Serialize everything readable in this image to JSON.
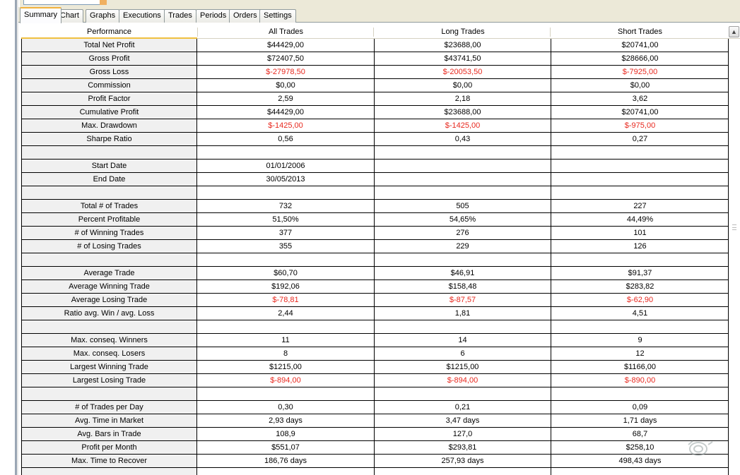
{
  "tabs": [
    "Summary",
    "Chart",
    "Graphs",
    "Executions",
    "Trades",
    "Periods",
    "Orders",
    "Settings"
  ],
  "active_tab": "Summary",
  "columns": [
    "Performance",
    "All Trades",
    "Long Trades",
    "Short Trades"
  ],
  "rows": [
    {
      "label": "Total Net Profit",
      "all": "$44429,00",
      "long": "$23688,00",
      "short": "$20741,00",
      "neg": [
        false,
        false,
        false
      ]
    },
    {
      "label": "Gross Profit",
      "all": "$72407,50",
      "long": "$43741,50",
      "short": "$28666,00",
      "neg": [
        false,
        false,
        false
      ]
    },
    {
      "label": "Gross Loss",
      "all": "$-27978,50",
      "long": "$-20053,50",
      "short": "$-7925,00",
      "neg": [
        true,
        true,
        true
      ]
    },
    {
      "label": "Commission",
      "all": "$0,00",
      "long": "$0,00",
      "short": "$0,00",
      "neg": [
        false,
        false,
        false
      ]
    },
    {
      "label": "Profit Factor",
      "all": "2,59",
      "long": "2,18",
      "short": "3,62",
      "neg": [
        false,
        false,
        false
      ]
    },
    {
      "label": "Cumulative Profit",
      "all": "$44429,00",
      "long": "$23688,00",
      "short": "$20741,00",
      "neg": [
        false,
        false,
        false
      ]
    },
    {
      "label": "Max. Drawdown",
      "all": "$-1425,00",
      "long": "$-1425,00",
      "short": "$-975,00",
      "neg": [
        true,
        true,
        true
      ]
    },
    {
      "label": "Sharpe Ratio",
      "all": "0,56",
      "long": "0,43",
      "short": "0,27",
      "neg": [
        false,
        false,
        false
      ]
    },
    {
      "label": "",
      "all": "",
      "long": "",
      "short": "",
      "neg": [
        false,
        false,
        false
      ]
    },
    {
      "label": "Start Date",
      "all": "01/01/2006",
      "long": "",
      "short": "",
      "neg": [
        false,
        false,
        false
      ]
    },
    {
      "label": "End Date",
      "all": "30/05/2013",
      "long": "",
      "short": "",
      "neg": [
        false,
        false,
        false
      ]
    },
    {
      "label": "",
      "all": "",
      "long": "",
      "short": "",
      "neg": [
        false,
        false,
        false
      ]
    },
    {
      "label": "Total # of Trades",
      "all": "732",
      "long": "505",
      "short": "227",
      "neg": [
        false,
        false,
        false
      ]
    },
    {
      "label": "Percent Profitable",
      "all": "51,50%",
      "long": "54,65%",
      "short": "44,49%",
      "neg": [
        false,
        false,
        false
      ]
    },
    {
      "label": "# of Winning Trades",
      "all": "377",
      "long": "276",
      "short": "101",
      "neg": [
        false,
        false,
        false
      ]
    },
    {
      "label": "# of Losing Trades",
      "all": "355",
      "long": "229",
      "short": "126",
      "neg": [
        false,
        false,
        false
      ]
    },
    {
      "label": "",
      "all": "",
      "long": "",
      "short": "",
      "neg": [
        false,
        false,
        false
      ]
    },
    {
      "label": "Average Trade",
      "all": "$60,70",
      "long": "$46,91",
      "short": "$91,37",
      "neg": [
        false,
        false,
        false
      ]
    },
    {
      "label": "Average Winning Trade",
      "all": "$192,06",
      "long": "$158,48",
      "short": "$283,82",
      "neg": [
        false,
        false,
        false
      ]
    },
    {
      "label": "Average Losing Trade",
      "all": "$-78,81",
      "long": "$-87,57",
      "short": "$-62,90",
      "neg": [
        true,
        true,
        true
      ]
    },
    {
      "label": "Ratio avg. Win / avg. Loss",
      "all": "2,44",
      "long": "1,81",
      "short": "4,51",
      "neg": [
        false,
        false,
        false
      ]
    },
    {
      "label": "",
      "all": "",
      "long": "",
      "short": "",
      "neg": [
        false,
        false,
        false
      ]
    },
    {
      "label": "Max. conseq. Winners",
      "all": "11",
      "long": "14",
      "short": "9",
      "neg": [
        false,
        false,
        false
      ]
    },
    {
      "label": "Max. conseq. Losers",
      "all": "8",
      "long": "6",
      "short": "12",
      "neg": [
        false,
        false,
        false
      ]
    },
    {
      "label": "Largest Winning Trade",
      "all": "$1215,00",
      "long": "$1215,00",
      "short": "$1166,00",
      "neg": [
        false,
        false,
        false
      ]
    },
    {
      "label": "Largest Losing Trade",
      "all": "$-894,00",
      "long": "$-894,00",
      "short": "$-890,00",
      "neg": [
        true,
        true,
        true
      ]
    },
    {
      "label": "",
      "all": "",
      "long": "",
      "short": "",
      "neg": [
        false,
        false,
        false
      ]
    },
    {
      "label": "# of Trades per Day",
      "all": "0,30",
      "long": "0,21",
      "short": "0,09",
      "neg": [
        false,
        false,
        false
      ]
    },
    {
      "label": "Avg. Time in Market",
      "all": "2,93 days",
      "long": "3,47 days",
      "short": "1,71 days",
      "neg": [
        false,
        false,
        false
      ]
    },
    {
      "label": "Avg. Bars in Trade",
      "all": "108,9",
      "long": "127,0",
      "short": "68,7",
      "neg": [
        false,
        false,
        false
      ]
    },
    {
      "label": "Profit per Month",
      "all": "$551,07",
      "long": "$293,81",
      "short": "$258,10",
      "neg": [
        false,
        false,
        false
      ]
    },
    {
      "label": "Max. Time to Recover",
      "all": "186,76 days",
      "long": "257,93 days",
      "short": "498,43 days",
      "neg": [
        false,
        false,
        false
      ]
    },
    {
      "label": "",
      "all": "",
      "long": "",
      "short": "",
      "neg": [
        false,
        false,
        false
      ]
    }
  ],
  "colors": {
    "negative": "#e8281e",
    "label_bg": "#f0f0f0",
    "active_tab_accent": "#f2b23e"
  },
  "icons": {
    "scroll_up": "chevron-up-icon",
    "watermark": "jetscreenshot-logo"
  }
}
